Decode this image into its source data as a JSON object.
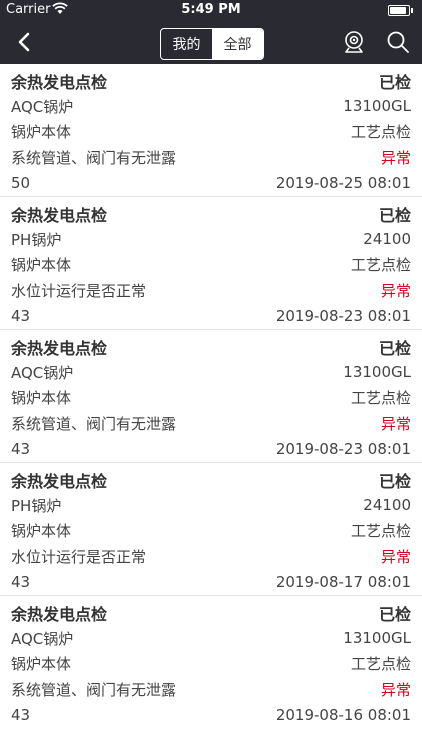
{
  "status_bar": {
    "carrier": "Carrier",
    "time": "5:49 PM"
  },
  "nav": {
    "tabs": [
      {
        "label": "我的",
        "active": false
      },
      {
        "label": "全部",
        "active": true
      }
    ]
  },
  "records": [
    {
      "title": "余热发电点检",
      "status": "已检",
      "equipment": "AQC锅炉",
      "code": "13100GL",
      "part": "锅炉本体",
      "type": "工艺点检",
      "item": "系统管道、阀门有无泄露",
      "result": "异常",
      "count": "50",
      "datetime": "2019-08-25 08:01"
    },
    {
      "title": "余热发电点检",
      "status": "已检",
      "equipment": "PH锅炉",
      "code": "24100",
      "part": "锅炉本体",
      "type": "工艺点检",
      "item": "水位计运行是否正常",
      "result": "异常",
      "count": "43",
      "datetime": "2019-08-23 08:01"
    },
    {
      "title": "余热发电点检",
      "status": "已检",
      "equipment": "AQC锅炉",
      "code": "13100GL",
      "part": "锅炉本体",
      "type": "工艺点检",
      "item": "系统管道、阀门有无泄露",
      "result": "异常",
      "count": "43",
      "datetime": "2019-08-23 08:01"
    },
    {
      "title": "余热发电点检",
      "status": "已检",
      "equipment": "PH锅炉",
      "code": "24100",
      "part": "锅炉本体",
      "type": "工艺点检",
      "item": "水位计运行是否正常",
      "result": "异常",
      "count": "43",
      "datetime": "2019-08-17 08:01"
    },
    {
      "title": "余热发电点检",
      "status": "已检",
      "equipment": "AQC锅炉",
      "code": "13100GL",
      "part": "锅炉本体",
      "type": "工艺点检",
      "item": "系统管道、阀门有无泄露",
      "result": "异常",
      "count": "43",
      "datetime": "2019-08-16 08:01"
    }
  ],
  "colors": {
    "nav_background": "#2a2a33",
    "abnormal": "#d0021b"
  },
  "icons": {
    "back": "chevron-left-icon",
    "scan": "camera-icon",
    "search": "search-icon",
    "wifi": "wifi-icon",
    "battery": "battery-icon"
  }
}
